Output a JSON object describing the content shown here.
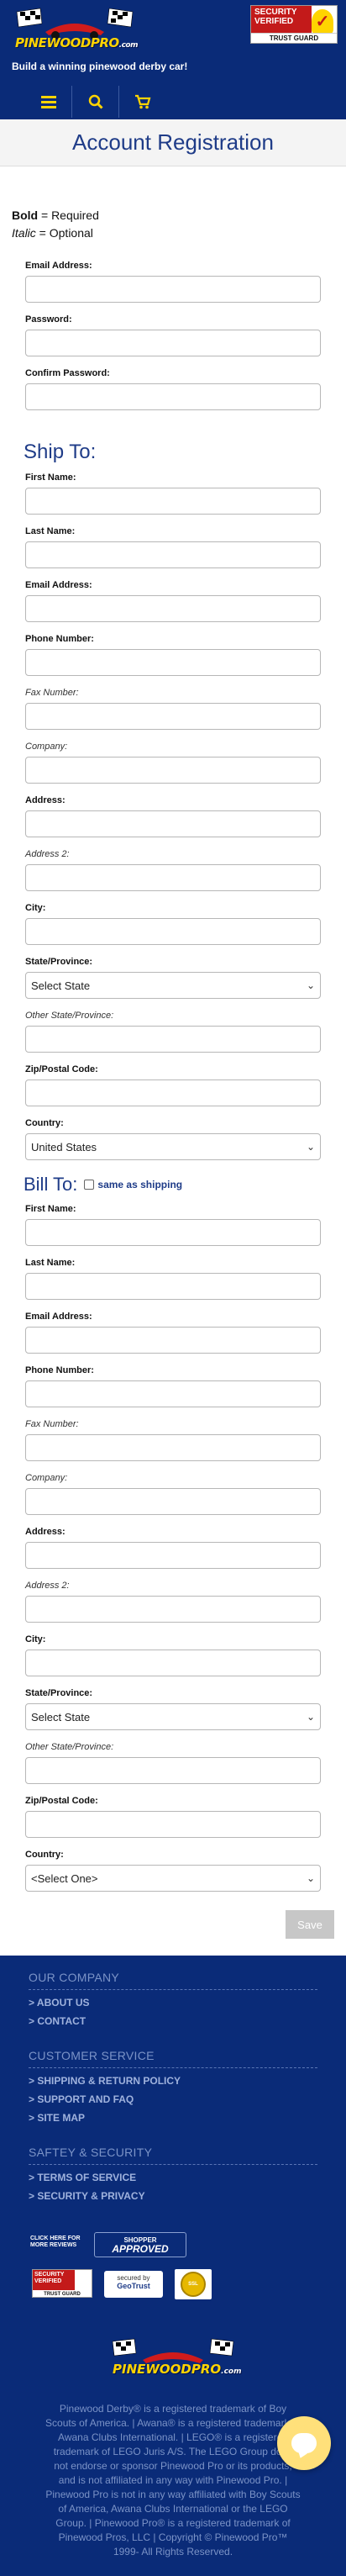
{
  "header": {
    "logo_text": "PINEWOODPRO",
    "logo_suffix": ".com",
    "seal_line1": "SECURITY",
    "seal_line2": "VERIFIED",
    "seal_bottom": "TRUST GUARD",
    "tagline": "Build a winning pinewood derby car!",
    "nav_icons": [
      "menu-icon",
      "search-icon",
      "cart-icon"
    ],
    "colors": {
      "navy": "#0a2b78",
      "gold": "#ffd400",
      "title_blue": "#1f3c88"
    }
  },
  "page_title": "Account Registration",
  "legend": {
    "bold_label": "Bold",
    "bold_text": " = Required",
    "italic_label": "Italic",
    "italic_text": " = Optional"
  },
  "account": {
    "email_label": "Email Address:",
    "password_label": "Password:",
    "confirm_label": "Confirm Password:"
  },
  "ship": {
    "heading": "Ship To:",
    "first_name": "First Name:",
    "last_name": "Last Name:",
    "email": "Email Address:",
    "phone": "Phone Number:",
    "fax": "Fax Number:",
    "company": "Company:",
    "address": "Address:",
    "address2": "Address 2:",
    "city": "City:",
    "state": "State/Province:",
    "state_value": "Select State",
    "other_state": "Other State/Province:",
    "zip": "Zip/Postal Code:",
    "country": "Country:",
    "country_value": "United States"
  },
  "bill": {
    "heading": "Bill To:",
    "same_as_shipping": "same as shipping",
    "first_name": "First Name:",
    "last_name": "Last Name:",
    "email": "Email Address:",
    "phone": "Phone Number:",
    "fax": "Fax Number:",
    "company": "Company:",
    "address": "Address:",
    "address2": "Address 2:",
    "city": "City:",
    "state": "State/Province:",
    "state_value": "Select State",
    "other_state": "Other State/Province:",
    "zip": "Zip/Postal Code:",
    "country": "Country:",
    "country_value": "<Select One>"
  },
  "save_label": "Save",
  "footer": {
    "company_heading": "OUR COMPANY",
    "about": "> ABOUT US",
    "contact": "> CONTACT",
    "service_heading": "CUSTOMER SERVICE",
    "shipping": "> SHIPPING & RETURN POLICY",
    "support": "> SUPPORT AND FAQ",
    "sitemap": "> SITE MAP",
    "safety_heading": "SAFTEY & SECURITY",
    "terms": "> TERMS OF SERVICE",
    "privacy": "> SECURITY & PRIVACY",
    "click_reviews": "CLICK HERE FOR MORE REVIEWS",
    "shopper_top": "SHOPPER",
    "shopper_main": "APPROVED",
    "small_seal_top": "SECURITY VERIFIED",
    "small_seal_bottom": "TRUST GUARD",
    "geotrust_top": "secured by",
    "geotrust_name": "GeoTrust",
    "ssl_badge": "SSL",
    "legal": "Pinewood Derby® is a registered trademark of Boy Scouts of America. | Awana® is a registered trademark of Awana Clubs International. | LEGO® is a registered trademark of LEGO Juris A/S. The LEGO Group does not endorse or sponsor Pinewood Pro or its products, and is not affiliated in any way with Pinewood Pro. | Pinewood Pro is not in any way affiliated with Boy Scouts of America, Awana Clubs International or the LEGO Group. | Pinewood Pro® is a registered trademark of Pinewood Pros, LLC | Copyright © Pinewood Pro™ 1999- All Rights Reserved."
  }
}
